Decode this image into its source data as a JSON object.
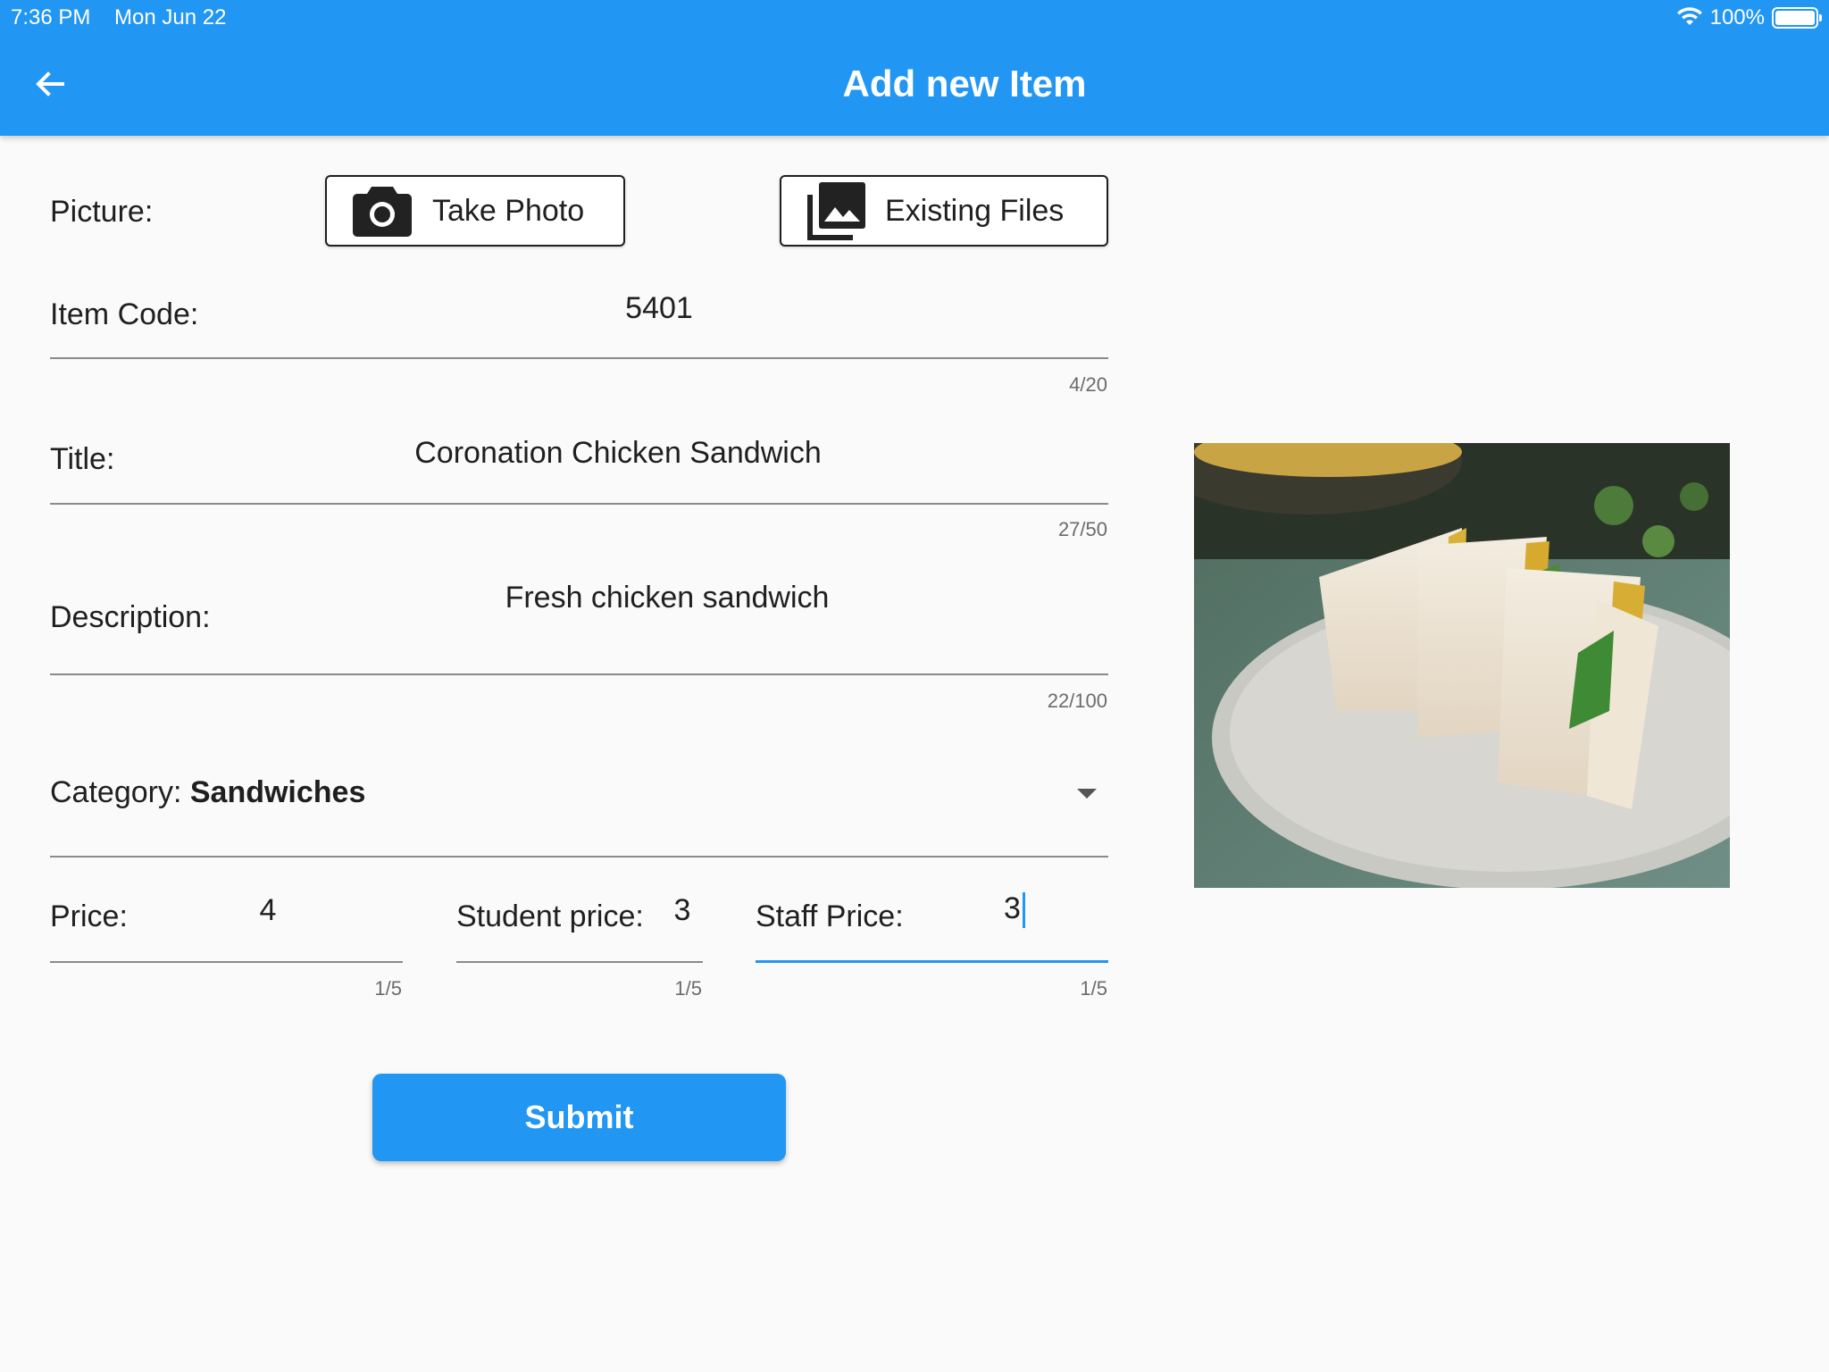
{
  "status_bar": {
    "time": "7:36 PM",
    "date": "Mon Jun 22",
    "battery": "100%"
  },
  "app_bar": {
    "title": "Add new Item"
  },
  "picture": {
    "label": "Picture:",
    "take_photo": "Take Photo",
    "existing_files": "Existing Files"
  },
  "item_code": {
    "label": "Item Code:",
    "value": "5401",
    "counter": "4/20"
  },
  "title_field": {
    "label": "Title:",
    "value": "Coronation Chicken Sandwich",
    "counter": "27/50"
  },
  "description": {
    "label": "Description:",
    "value": "Fresh chicken sandwich",
    "counter": "22/100"
  },
  "category": {
    "label": "Category: ",
    "value": "Sandwiches"
  },
  "price": {
    "label": "Price:",
    "value": "4",
    "counter": "1/5"
  },
  "student_price": {
    "label": "Student price:",
    "value": "3",
    "counter": "1/5"
  },
  "staff_price": {
    "label": "Staff Price:",
    "value": "3",
    "counter": "1/5"
  },
  "submit": {
    "label": "Submit"
  },
  "colors": {
    "primary": "#2196f3",
    "background": "#fafafa"
  },
  "icons": [
    "wifi-icon",
    "battery-icon",
    "back-arrow-icon",
    "camera-icon",
    "photo-library-icon",
    "dropdown-caret-icon"
  ]
}
